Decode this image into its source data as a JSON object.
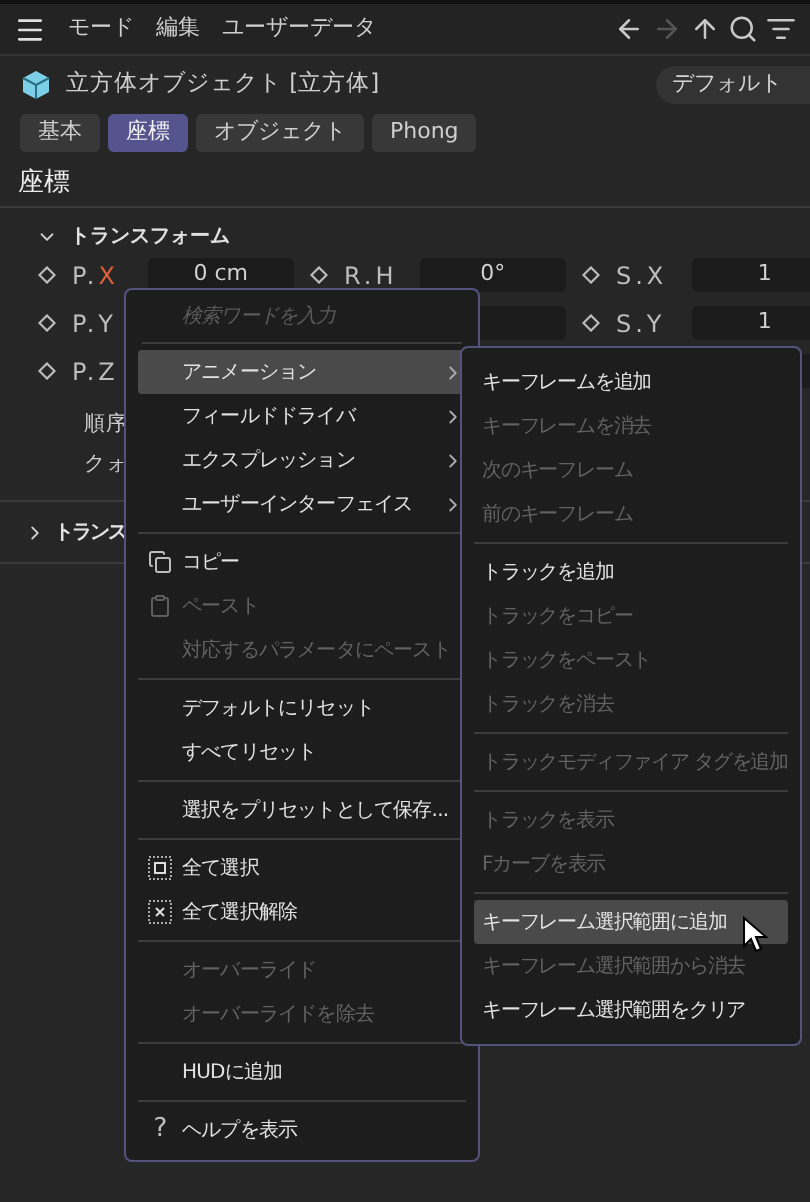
{
  "menubar": {
    "items": [
      "モード",
      "編集",
      "ユーザーデータ"
    ]
  },
  "nav": [
    {
      "kind": "back",
      "disabled": false
    },
    {
      "kind": "forward",
      "disabled": true
    },
    {
      "kind": "up",
      "disabled": false
    },
    {
      "kind": "search",
      "disabled": false
    },
    {
      "kind": "filter",
      "disabled": false
    }
  ],
  "object": {
    "title": "立方体オブジェクト [立方体]",
    "preset": "デフォルト"
  },
  "tabs": [
    {
      "label": "基本",
      "selected": false
    },
    {
      "label": "座標",
      "selected": true
    },
    {
      "label": "オブジェクト",
      "selected": false
    },
    {
      "label": "Phong",
      "selected": false
    }
  ],
  "section_title": "座標",
  "group": {
    "title": "トランスフォーム",
    "expanded": true
  },
  "rows": [
    {
      "cells": [
        {
          "label": "P.X",
          "accent": true,
          "value": "0 cm"
        },
        {
          "label": "R.H",
          "accent": false,
          "value": "0°"
        },
        {
          "label": "S.X",
          "accent": false,
          "value": "1"
        }
      ]
    },
    {
      "cells": [
        {
          "kind": "label_only",
          "label": "P.Y",
          "accent": false
        },
        {
          "kind": "field"
        },
        {
          "kind": "field",
          "label": "S.Y",
          "accent": false,
          "value": "1"
        }
      ]
    },
    {
      "cells": [
        {
          "kind": "label_only",
          "label": "P.Z",
          "accent": false
        },
        {
          "kind": "blank"
        },
        {
          "kind": "field"
        }
      ]
    }
  ],
  "extra_rows": [
    "順序",
    "クォ"
  ],
  "group2": {
    "title": "トランス",
    "expanded": false
  },
  "context_menu": {
    "placeholder": "検索ワードを入力",
    "items": [
      {
        "kind": "item",
        "label": "アニメーション",
        "submenu": true,
        "highlighted": true,
        "disabled": false
      },
      {
        "kind": "item",
        "label": "フィールドドライバ",
        "submenu": true,
        "highlighted": false,
        "disabled": false
      },
      {
        "kind": "item",
        "label": "エクスプレッション",
        "submenu": true,
        "highlighted": false,
        "disabled": false
      },
      {
        "kind": "item",
        "label": "ユーザーインターフェイス",
        "submenu": true,
        "highlighted": false,
        "disabled": false
      },
      {
        "kind": "separator"
      },
      {
        "kind": "copy",
        "label": "コピー",
        "highlighted": false,
        "disabled": false
      },
      {
        "kind": "paste",
        "label": "ペースト",
        "highlighted": false,
        "disabled": true
      },
      {
        "kind": "item",
        "label": "対応するパラメータにペースト",
        "highlighted": false,
        "disabled": true
      },
      {
        "kind": "separator"
      },
      {
        "kind": "item",
        "label": "デフォルトにリセット",
        "highlighted": false,
        "disabled": false
      },
      {
        "kind": "item",
        "label": "すべてリセット",
        "highlighted": false,
        "disabled": false
      },
      {
        "kind": "separator"
      },
      {
        "kind": "item",
        "label": "選択をプリセットとして保存...",
        "highlighted": false,
        "disabled": false
      },
      {
        "kind": "separator"
      },
      {
        "kind": "select_all",
        "label": "全て選択",
        "highlighted": false,
        "disabled": false
      },
      {
        "kind": "deselect_all",
        "label": "全て選択解除",
        "highlighted": false,
        "disabled": false
      },
      {
        "kind": "separator"
      },
      {
        "kind": "item",
        "label": "オーバーライド",
        "highlighted": false,
        "disabled": true
      },
      {
        "kind": "item",
        "label": "オーバーライドを除去",
        "highlighted": false,
        "disabled": true
      },
      {
        "kind": "separator"
      },
      {
        "kind": "item",
        "label": "HUDに追加",
        "highlighted": false,
        "disabled": false
      },
      {
        "kind": "separator"
      },
      {
        "kind": "item",
        "label": "ヘルプを表示",
        "glyph": "?",
        "highlighted": false,
        "disabled": false
      }
    ]
  },
  "submenu": {
    "items": [
      {
        "kind": "item",
        "label": "キーフレームを追加",
        "highlighted": false,
        "disabled": false
      },
      {
        "kind": "item",
        "label": "キーフレームを消去",
        "highlighted": false,
        "disabled": true
      },
      {
        "kind": "item",
        "label": "次のキーフレーム",
        "highlighted": false,
        "disabled": true
      },
      {
        "kind": "item",
        "label": "前のキーフレーム",
        "highlighted": false,
        "disabled": true
      },
      {
        "kind": "separator"
      },
      {
        "kind": "item",
        "label": "トラックを追加",
        "highlighted": false,
        "disabled": false
      },
      {
        "kind": "item",
        "label": "トラックをコピー",
        "highlighted": false,
        "disabled": true
      },
      {
        "kind": "item",
        "label": "トラックをペースト",
        "highlighted": false,
        "disabled": true
      },
      {
        "kind": "item",
        "label": "トラックを消去",
        "highlighted": false,
        "disabled": true
      },
      {
        "kind": "separator"
      },
      {
        "kind": "item",
        "label": "トラックモディファイア タグを追加",
        "highlighted": false,
        "disabled": true
      },
      {
        "kind": "separator"
      },
      {
        "kind": "item",
        "label": "トラックを表示",
        "highlighted": false,
        "disabled": true
      },
      {
        "kind": "item",
        "label": "Fカーブを表示",
        "highlighted": false,
        "disabled": true
      },
      {
        "kind": "separator"
      },
      {
        "kind": "item",
        "label": "キーフレーム選択範囲に追加",
        "highlighted": true,
        "disabled": false
      },
      {
        "kind": "item",
        "label": "キーフレーム選択範囲から消去",
        "highlighted": false,
        "disabled": true
      },
      {
        "kind": "item",
        "label": "キーフレーム選択範囲をクリア",
        "highlighted": false,
        "disabled": false
      }
    ]
  }
}
